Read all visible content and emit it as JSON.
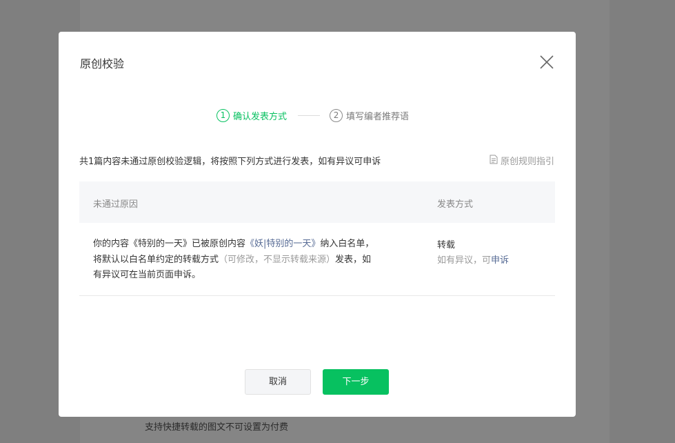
{
  "dialog": {
    "title": "原创校验"
  },
  "steps": [
    {
      "number": "1",
      "label": "确认发表方式",
      "active": true
    },
    {
      "number": "2",
      "label": "填写编者推荐语",
      "active": false
    }
  ],
  "summary": "共1篇内容未通过原创校验逻辑，将按照下列方式进行发表，如有异议可申诉",
  "rules_link": "原创规则指引",
  "table": {
    "headers": {
      "reason": "未通过原因",
      "method": "发表方式"
    },
    "row": {
      "reason_prefix": "你的内容《特别的一天》已被原创内容",
      "reason_link": "《妖|特别的一天》",
      "reason_middle": "纳入白名单，将默认以白名单约定的转载方式",
      "reason_muted": "（可修改，不显示转载来源）",
      "reason_suffix": "发表，如有异议可在当前页面申诉。",
      "method": "转载",
      "appeal_prefix": "如有异议，可",
      "appeal_link": "申诉"
    }
  },
  "buttons": {
    "cancel": "取消",
    "next": "下一步"
  },
  "background_note": "支持快捷转载的图文不可设置为付费",
  "colors": {
    "accent": "#07c160",
    "link": "#576b95"
  }
}
